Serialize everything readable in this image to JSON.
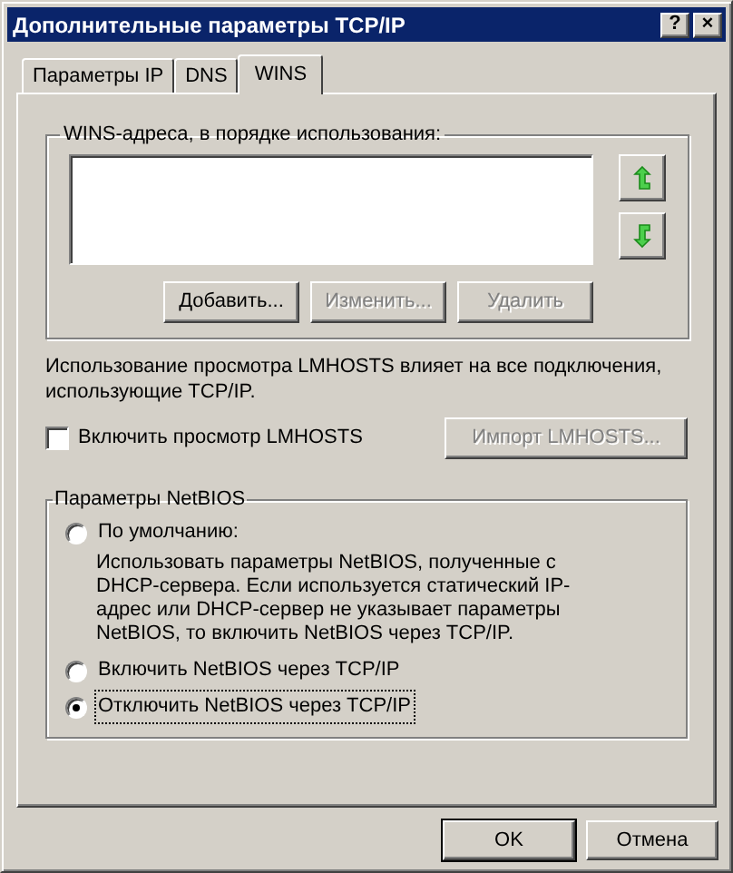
{
  "window": {
    "title": "Дополнительные параметры TCP/IP",
    "title_buttons": [
      "?",
      "×"
    ]
  },
  "tabs": [
    {
      "label": "Параметры IP",
      "selected": false
    },
    {
      "label": "DNS",
      "selected": false
    },
    {
      "label": "WINS",
      "selected": true
    }
  ],
  "wins_group": {
    "label": "WINS-адреса, в порядке использования:",
    "buttons": [
      {
        "label": "Добавить...",
        "disabled": false
      },
      {
        "label": "Изменить...",
        "disabled": true
      },
      {
        "label": "Удалить",
        "disabled": true
      }
    ]
  },
  "lmhosts": {
    "note": "Использование просмотра LMHOSTS влияет на все подключения, использующие TCP/IP.",
    "checkbox": {
      "label": "Включить просмотр LMHOSTS",
      "checked": false
    },
    "import_button": {
      "label": "Импорт LMHOSTS...",
      "disabled": true
    }
  },
  "netbios": {
    "label": "Параметры NetBIOS",
    "options": [
      {
        "label": "По умолчанию:",
        "description": "Использовать параметры NetBIOS, полученные с DHCP-сервера. Если используется статический IP-адрес или DHCP-сервер не указывает параметры NetBIOS, то включить NetBIOS через TCP/IP.",
        "selected": false,
        "focused": false
      },
      {
        "label": "Включить NetBIOS через TCP/IP",
        "selected": false,
        "focused": false
      },
      {
        "label": "Отключить NetBIOS через TCP/IP",
        "selected": true,
        "focused": true
      }
    ]
  },
  "footer_buttons": [
    {
      "label": "OK",
      "default": true
    },
    {
      "label": "Отмена",
      "default": false
    }
  ]
}
